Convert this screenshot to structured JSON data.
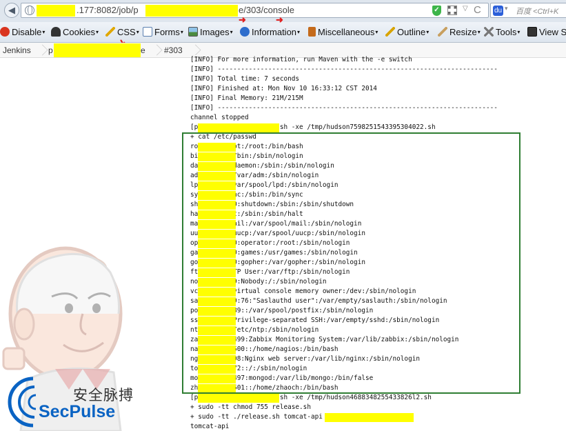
{
  "address_bar": {
    "url_visible_1": ".177:8082/job/p",
    "url_visible_2": "e/303/console",
    "search_placeholder": "百度 <Ctrl+K",
    "back_glyph": "◀",
    "dropdown_glyph": "▽",
    "reload_glyph": "C",
    "baidu_glyph": "du"
  },
  "toolbar": {
    "items": [
      {
        "label": "Disable",
        "icon": "disable-icon",
        "color": "#d9341f"
      },
      {
        "label": "Cookies",
        "icon": "cookies-icon",
        "color": "#333333"
      },
      {
        "label": "CSS",
        "icon": "css-icon",
        "color": "#e0a800"
      },
      {
        "label": "Forms",
        "icon": "forms-icon",
        "color": "#5a7fb0"
      },
      {
        "label": "Images",
        "icon": "images-icon",
        "color": "#4c8b3f"
      },
      {
        "label": "Information",
        "icon": "information-icon",
        "color": "#2d6dcc"
      },
      {
        "label": "Miscellaneous",
        "icon": "miscellaneous-icon",
        "color": "#c46a1b"
      },
      {
        "label": "Outline",
        "icon": "outline-icon",
        "color": "#d8a400"
      },
      {
        "label": "Resize",
        "icon": "resize-icon",
        "color": "#c8a060"
      },
      {
        "label": "Tools",
        "icon": "tools-icon",
        "color": "#777777"
      },
      {
        "label": "View S",
        "icon": "view-source-icon",
        "color": "#333333"
      }
    ]
  },
  "breadcrumb": {
    "home": "Jenkins",
    "job_visible_start": "p",
    "job_visible_end": "e",
    "build": "#303"
  },
  "watermark": {
    "cn": "安全脉搏",
    "en": "SecPulse"
  },
  "console": {
    "lines": [
      "[INFO] For more information, run Maven with the -e switch",
      "[INFO] ------------------------------------------------------------------------",
      "[INFO] Total time: 7 seconds",
      "[INFO] Finished at: Mon Nov 10 16:33:12 CST 2014",
      "[INFO] Final Memory: 21M/215M",
      "[INFO] ------------------------------------------------------------------------",
      "channel stopped",
      "[p            ] $ /bin/sh -xe /tmp/hudson7598251543395304022.sh",
      "+ cat /etc/passwd",
      "ro         ot:/root:/bin/bash",
      "bi         /bin:/sbin/nologin",
      "da         daemon:/sbin:/sbin/nologin",
      "ad         /var/adm:/sbin/nologin",
      "lp         var/spool/lpd:/sbin/nologin",
      "sy         nc:/sbin:/bin/sync",
      "sh         0:shutdown:/sbin:/sbin/shutdown",
      "ha         t:/sbin:/sbin/halt",
      "ma         ail:/var/spool/mail:/sbin/nologin",
      "uu         uucp:/var/spool/uucp:/sbin/nologin",
      "op         0:operator:/root:/sbin/nologin",
      "ga         0:games:/usr/games:/sbin/nologin",
      "go         0:gopher:/var/gopher:/sbin/nologin",
      "ft         TP User:/var/ftp:/sbin/nologin",
      "no         9:Nobody:/:/sbin/nologin",
      "vc         virtual console memory owner:/dev:/sbin/nologin",
      "sa         9:76:\"Saslauthd user\":/var/empty/saslauth:/sbin/nologin",
      "po         89::/var/spool/postfix:/sbin/nologin",
      "ss         Privilege-separated SSH:/var/empty/sshd:/sbin/nologin",
      "nt         /etc/ntp:/sbin/nologin",
      "za         499:Zabbix Monitoring System:/var/lib/zabbix:/sbin/nologin",
      "na         500::/home/nagios:/bin/bash",
      "ng         98:Nginx web server:/var/lib/nginx:/sbin/nologin",
      "to         72::/:/sbin/nologin",
      "mo         497:mongod:/var/lib/mongo:/bin/false",
      "zh         501::/home/zhaoch:/bin/bash",
      "[p            ] $ /bin/sh -xe /tmp/hudson4688348255433826l2.sh",
      "+ sudo -tt chmod 755 release.sh",
      "+ sudo -tt ./release.sh tomcat-api p",
      "tomcat-api"
    ]
  },
  "colors": {
    "redaction": "#ffff00",
    "highlight_frame": "#2e7d32",
    "annotation_arrow": "#e02020",
    "secpulse_blue": "#0a63c3"
  }
}
